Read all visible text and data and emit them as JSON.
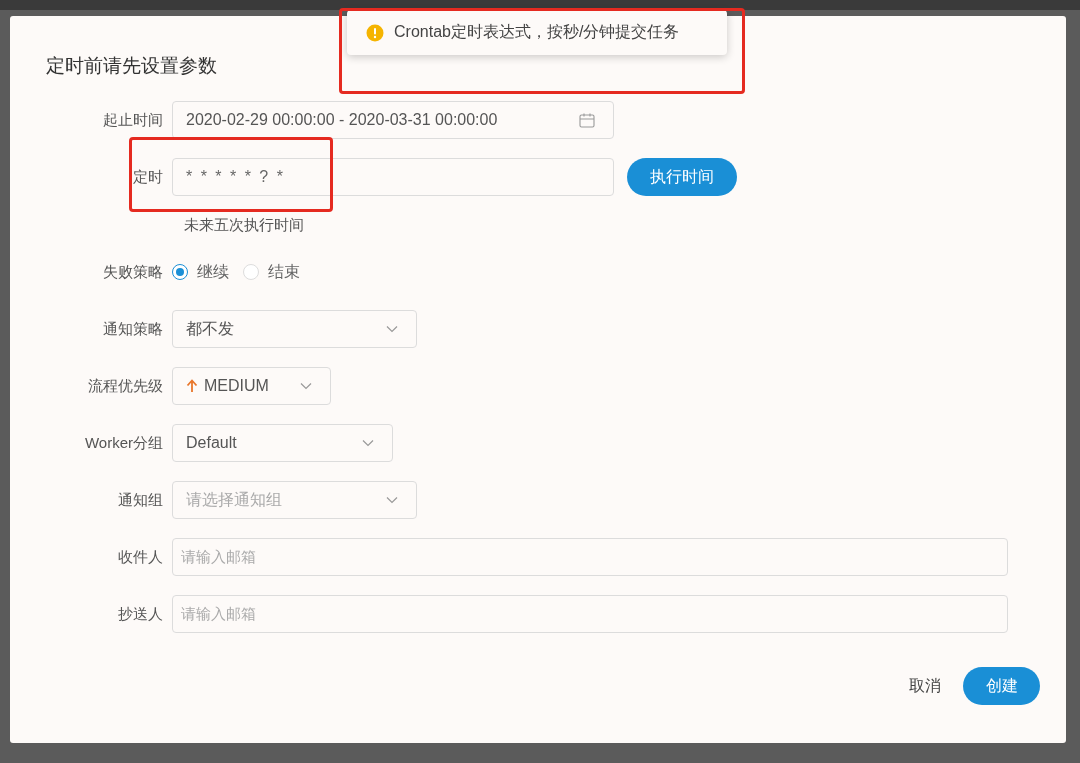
{
  "toast": {
    "kind": "warning",
    "message": "Crontab定时表达式，按秒/分钟提交任务",
    "highlighted": true
  },
  "dialog": {
    "title": "定时前请先设置参数"
  },
  "form": [
    {
      "kind": "date-range",
      "label": "起止时间",
      "value": "2020-02-29 00:00:00 - 2020-03-31 00:00:00"
    },
    {
      "kind": "cron",
      "label": "定时",
      "value": "* * * * * ? *",
      "button": "执行时间",
      "hint": "未来五次执行时间",
      "highlighted": true
    },
    {
      "kind": "radio",
      "label": "失败策略",
      "options": [
        {
          "label": "继续",
          "selected": true
        },
        {
          "label": "结束",
          "selected": false
        }
      ]
    },
    {
      "kind": "select",
      "label": "通知策略",
      "value": "都不发"
    },
    {
      "kind": "priority",
      "label": "流程优先级",
      "value": "MEDIUM"
    },
    {
      "kind": "select",
      "label": "Worker分组",
      "value": "Default"
    },
    {
      "kind": "select",
      "label": "通知组",
      "placeholder": "请选择通知组"
    },
    {
      "kind": "text",
      "label": "收件人",
      "placeholder": "请输入邮箱"
    },
    {
      "kind": "text",
      "label": "抄送人",
      "placeholder": "请输入邮箱"
    }
  ],
  "footer": {
    "buttons": [
      {
        "kind": "text",
        "label": "取消"
      },
      {
        "kind": "primary",
        "label": "创建"
      }
    ]
  }
}
